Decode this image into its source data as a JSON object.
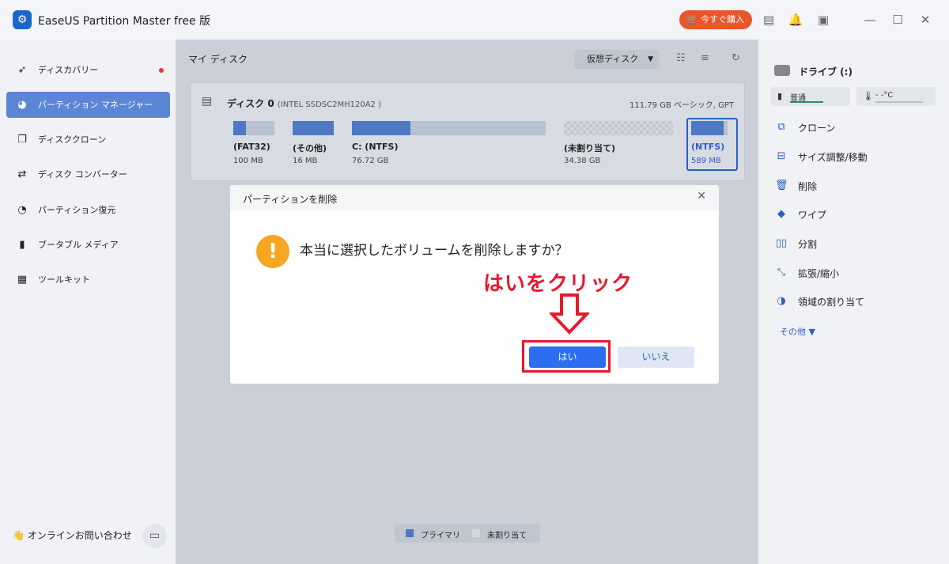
{
  "titlebar": {
    "app_title": "EaseUS Partition Master free 版",
    "buy_label": "今すぐ購入",
    "icons": [
      "notes-icon",
      "bell-icon",
      "menu-icon",
      "minimize-icon",
      "maximize-icon",
      "close-icon"
    ]
  },
  "sidebar": {
    "items": [
      {
        "label": "ディスカバリー",
        "icon": "compass-icon"
      },
      {
        "label": "パーティション マネージャー",
        "icon": "pie-chart-icon"
      },
      {
        "label": "ディスククローン",
        "icon": "copy-icon"
      },
      {
        "label": "ディスク コンバーター",
        "icon": "convert-icon"
      },
      {
        "label": "パーティション復元",
        "icon": "recover-icon"
      },
      {
        "label": "ブータブル メディア",
        "icon": "usb-icon"
      },
      {
        "label": "ツールキット",
        "icon": "toolbox-icon"
      }
    ],
    "active_index": 1,
    "online_label": "オンラインお問い合わせ"
  },
  "main": {
    "title": "マイ ディスク",
    "virtual_disk_label": "仮想ディスク",
    "disk": {
      "name": "ディスク 0",
      "model": "(INTEL SSDSC2MH120A2 )",
      "info": "111.79 GB ベーシック, GPT",
      "partitions": [
        {
          "label": "(FAT32)",
          "size": "100 MB",
          "fill": 0.3
        },
        {
          "label": "(その他)",
          "size": "16 MB",
          "fill": 1.0
        },
        {
          "label": "C: (NTFS)",
          "size": "76.72 GB",
          "fill": 0.3
        },
        {
          "label": "(未割り当て)",
          "size": "34.38 GB",
          "fill": 0
        },
        {
          "label": "(NTFS)",
          "size": "589 MB",
          "fill": 0.9
        }
      ]
    },
    "legend": {
      "primary": "プライマリ",
      "unallocated": "未割り当て"
    }
  },
  "right_panel": {
    "drive_label": "ドライブ (:)",
    "status_label": "普通",
    "temp_label": "- -°C",
    "actions": [
      {
        "label": "クローン",
        "icon": "clone-icon"
      },
      {
        "label": "サイズ調整/移動",
        "icon": "resize-icon"
      },
      {
        "label": "削除",
        "icon": "trash-icon"
      },
      {
        "label": "ワイプ",
        "icon": "eraser-icon"
      },
      {
        "label": "分割",
        "icon": "split-icon"
      },
      {
        "label": "拡張/縮小",
        "icon": "extend-icon"
      },
      {
        "label": "領域の割り当て",
        "icon": "allocate-icon"
      }
    ],
    "more_label": "その他 ▼"
  },
  "dialog": {
    "title": "パーティションを削除",
    "message": "本当に選択したボリュームを削除しますか？",
    "yes_label": "はい",
    "no_label": "いいえ",
    "annotation": "はいをクリック"
  },
  "colors": {
    "accent": "#2b6ff0",
    "annotation": "#e8182e",
    "buy": "#e8572a",
    "warning": "#f5a623"
  }
}
